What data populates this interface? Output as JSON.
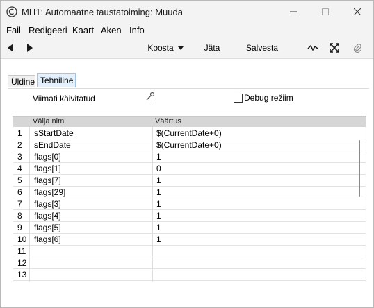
{
  "window": {
    "title": "MH1: Automaatne taustatoiming: Muuda",
    "minimize_glyph": "—",
    "maximize_glyph": "□",
    "close_glyph": "✕"
  },
  "menu": {
    "items": [
      {
        "label": "Fail"
      },
      {
        "label": "Redigeeri"
      },
      {
        "label": "Kaart"
      },
      {
        "label": "Aken"
      },
      {
        "label": "Info"
      }
    ]
  },
  "toolbar": {
    "prev_icon": "◀",
    "next_icon": "▶",
    "koosta_label": "Koosta",
    "koosta_arrow": "▼",
    "jata_label": "Jäta",
    "salvesta_label": "Salvesta"
  },
  "tabs": [
    {
      "label": "Üldine",
      "active": false
    },
    {
      "label": "Tehniline",
      "active": true
    }
  ],
  "form": {
    "last_run_label": "Viimati käivitatud",
    "last_run_value": "",
    "debug_label": "Debug režiim",
    "debug_checked": false
  },
  "grid": {
    "columns": {
      "name": "Välja nimi",
      "value": "Väärtus"
    },
    "rows": [
      {
        "num": "1",
        "name": "sStartDate",
        "value": "$(CurrentDate+0)"
      },
      {
        "num": "2",
        "name": "sEndDate",
        "value": "$(CurrentDate+0)"
      },
      {
        "num": "3",
        "name": "flags[0]",
        "value": "1"
      },
      {
        "num": "4",
        "name": "flags[1]",
        "value": "0"
      },
      {
        "num": "5",
        "name": "flags[7]",
        "value": "1"
      },
      {
        "num": "6",
        "name": "flags[29]",
        "value": "1"
      },
      {
        "num": "7",
        "name": "flags[3]",
        "value": "1"
      },
      {
        "num": "8",
        "name": "flags[4]",
        "value": "1"
      },
      {
        "num": "9",
        "name": "flags[5]",
        "value": "1"
      },
      {
        "num": "10",
        "name": "flags[6]",
        "value": "1"
      },
      {
        "num": "11",
        "name": "",
        "value": ""
      },
      {
        "num": "12",
        "name": "",
        "value": ""
      },
      {
        "num": "13",
        "name": "",
        "value": ""
      }
    ]
  },
  "colors": {
    "accent": "#1e6fd9",
    "tab_active_bg": "#e4f0fb"
  }
}
